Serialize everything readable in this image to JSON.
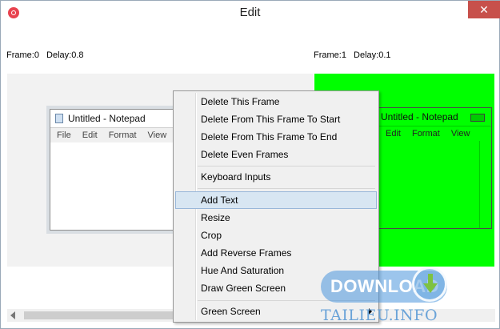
{
  "window": {
    "title": "Edit",
    "close_label": "✕"
  },
  "frames": [
    {
      "frame_label": "Frame:0",
      "delay_label": "Delay:0.8"
    },
    {
      "frame_label": "Frame:1",
      "delay_label": "Delay:0.1"
    }
  ],
  "notepad": {
    "title": "Untitled - Notepad",
    "menu": [
      "File",
      "Edit",
      "Format",
      "View"
    ]
  },
  "context_menu": {
    "groups": [
      [
        "Delete This Frame",
        "Delete From This Frame To Start",
        "Delete From This Frame To End",
        "Delete Even Frames"
      ],
      [
        "Keyboard Inputs"
      ],
      [
        "Add Text",
        "Resize",
        "Crop",
        "Add Reverse Frames",
        "Hue And Saturation",
        "Draw Green Screen"
      ],
      [
        "Green Screen"
      ]
    ],
    "highlighted": "Add Text"
  },
  "watermark": {
    "download": "DOWNLOAD",
    "site": "TAILIEU.INFO"
  },
  "colors": {
    "green_screen": "#00ff00",
    "close_button": "#c7504b",
    "menu_highlight": "#d8e6f2"
  }
}
